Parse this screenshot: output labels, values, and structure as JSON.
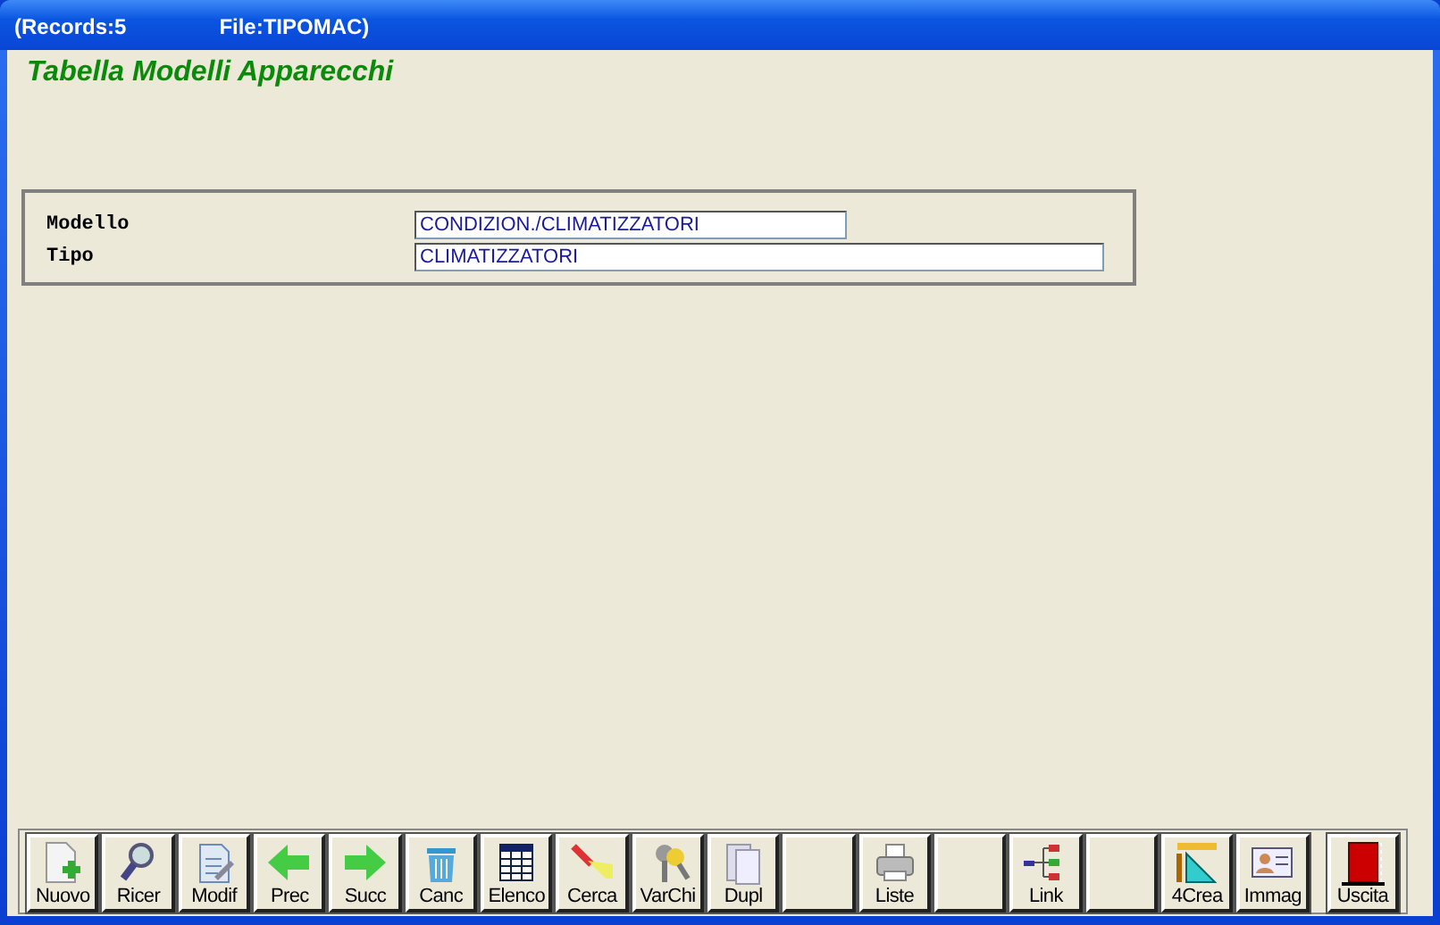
{
  "window": {
    "title": "(Records:5",
    "file": "File:TIPOMAC)"
  },
  "heading": "Tabella Modelli Apparecchi",
  "form": {
    "fields": [
      {
        "label": "Modello",
        "value": "CONDIZION./CLIMATIZZATORI",
        "kind": "short"
      },
      {
        "label": "Tipo",
        "value": "CLIMATIZZATORI",
        "kind": "long"
      }
    ]
  },
  "toolbar": [
    {
      "kind": "action",
      "label": "Nuovo"
    },
    {
      "kind": "action",
      "label": "Ricer"
    },
    {
      "kind": "action",
      "label": "Modif"
    },
    {
      "kind": "action",
      "label": "Prec"
    },
    {
      "kind": "action",
      "label": "Succ"
    },
    {
      "kind": "action",
      "label": "Canc"
    },
    {
      "kind": "action",
      "label": "Elenco"
    },
    {
      "kind": "action",
      "label": "Cerca"
    },
    {
      "kind": "action",
      "label": "VarChi"
    },
    {
      "kind": "action",
      "label": "Dupl"
    },
    {
      "kind": "blank"
    },
    {
      "kind": "action",
      "label": "Liste"
    },
    {
      "kind": "blank"
    },
    {
      "kind": "action",
      "label": "Link"
    },
    {
      "kind": "blank"
    },
    {
      "kind": "action",
      "label": "4Crea"
    },
    {
      "kind": "action",
      "label": "Immag"
    },
    {
      "kind": "exit",
      "label": "Uscita"
    }
  ]
}
